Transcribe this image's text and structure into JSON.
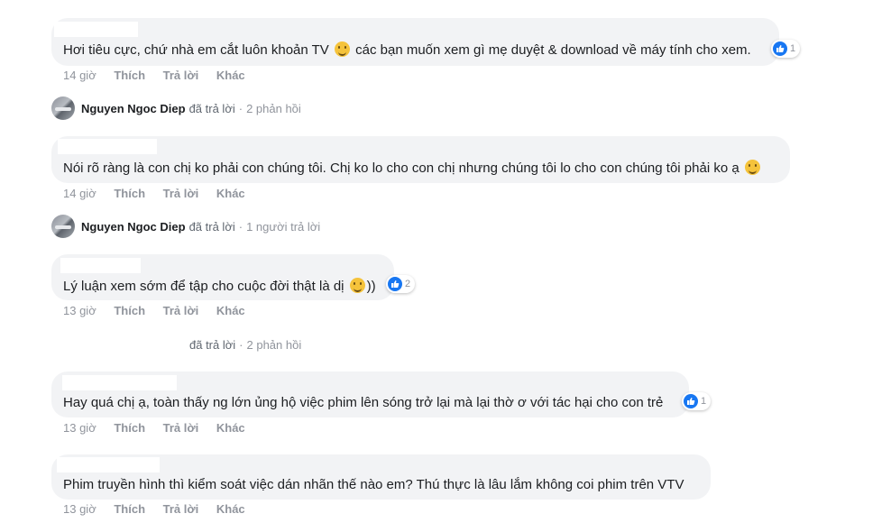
{
  "actions": {
    "like": "Thích",
    "reply": "Trả lời",
    "more": "Khác"
  },
  "comments": [
    {
      "text_before": "Hơi tiêu cực, chứ nhà em cắt luôn khoản TV",
      "emoji": "grinning-sweat-emoji",
      "text_after": "các bạn muốn xem gì mẹ duyệt & download về máy tính cho xem.",
      "time": "14 giờ",
      "like_count": "1"
    },
    {
      "text": "Nói rõ ràng là con chị ko phải con chúng tôi. Chị ko lo cho con chị nhưng chúng tôi lo cho con chúng tôi phải ko ạ",
      "emoji": "laughing-squint-emoji",
      "time": "14 giờ"
    },
    {
      "text": "Lý luận xem sớm để tập cho cuộc đời thật là dị",
      "emoji": "slight-smile-emoji",
      "text_after": "))",
      "time": "13 giờ",
      "like_count": "2"
    },
    {
      "text": "Hay quá chị ạ, toàn thấy ng lớn ủng hộ việc phim lên sóng trở lại mà lại thờ ơ với tác hại cho con trẻ",
      "time": "13 giờ",
      "like_count": "1"
    },
    {
      "text": "Phim truyền hình thì kiểm soát việc dán nhãn thế nào em? Thú thực là lâu lắm không coi phim trên VTV",
      "time": "13 giờ"
    }
  ],
  "replies": [
    {
      "name": "Nguyen Ngoc Diep",
      "verb": "đã trả lời",
      "sep": "·",
      "count": "2 phản hồi"
    },
    {
      "name": "Nguyen Ngoc Diep",
      "verb": "đã trả lời",
      "sep": "·",
      "count": "1 người trả lời"
    },
    {
      "name": "",
      "verb": "đã trả lời",
      "sep": "·",
      "count": "2 phản hồi"
    }
  ],
  "colors": {
    "bubble": "#f2f3f5",
    "meta": "#90949c",
    "like_blue": "#1877f2"
  }
}
